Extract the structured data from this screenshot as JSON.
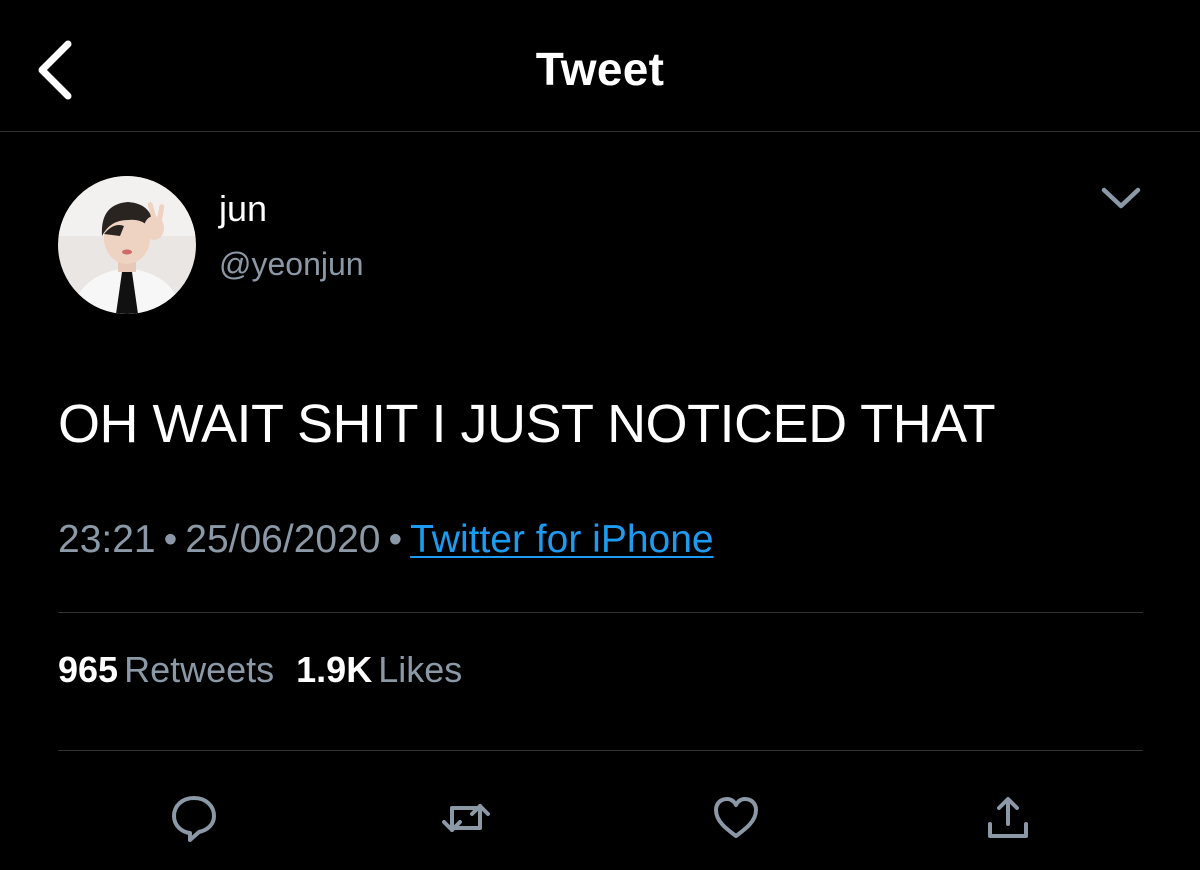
{
  "header": {
    "title": "Tweet",
    "back_icon": "chevron-left-icon"
  },
  "author": {
    "display_name": "jun",
    "handle": "@yeonjun",
    "avatar_icon": "avatar"
  },
  "tweet": {
    "text": "OH WAIT SHIT I JUST NOTICED THAT",
    "time": "23:21",
    "date": "25/06/2020",
    "separator": "•",
    "source": "Twitter for iPhone"
  },
  "stats": {
    "retweets_count": "965",
    "retweets_label": "Retweets",
    "likes_count": "1.9K",
    "likes_label": "Likes"
  },
  "actions": [
    "reply-icon",
    "retweet-icon",
    "like-icon",
    "share-icon"
  ],
  "colors": {
    "background": "#000000",
    "text": "#ffffff",
    "muted": "#8b98a5",
    "link": "#1d9bf0",
    "divider": "#2f3336"
  }
}
